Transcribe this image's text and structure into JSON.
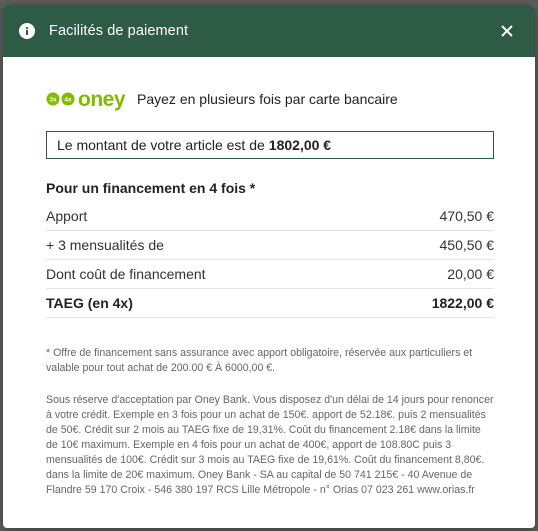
{
  "header": {
    "title": "Facilités de paiement",
    "info_icon": "info-icon",
    "close_icon": "close-icon",
    "background_color": "#2e5b45"
  },
  "brand": {
    "logo_small_1": "3x",
    "logo_small_2": "4x",
    "logo_text": "oney",
    "logo_color": "#81bc00",
    "tagline": "Payez en plusieurs fois par carte bancaire"
  },
  "amount_box": {
    "prefix": "Le montant de votre article est de",
    "value": "1802,00 €"
  },
  "financing": {
    "title": "Pour un financement en 4 fois *",
    "rows": [
      {
        "label": "Apport",
        "value": "470,50 €"
      },
      {
        "label": "+ 3 mensualités de",
        "value": "450,50 €"
      },
      {
        "label": "Dont coût de financement",
        "value": "20,00 €"
      },
      {
        "label": "TAEG (en 4x)",
        "value": "1822,00 €"
      }
    ]
  },
  "footnote": "* Offre de financement sans assurance avec apport obligatoire, réservée aux particuliers et valable pour tout achat de 200.00 € À 6000,00 €.",
  "legal": "Sous réserve d'acceptation par Oney Bank. Vous disposez d'un délai de 14 jours pour renoncer à votre crédit. Exemple en 3 fois pour un achat de 150€. apport de 52.18€. puis 2 mensualités de 50€. Crédit sur 2 mois au TAEG fixe de 19,31%. Coût du financement 2.18€ dans la limite de 10€ maximum. Exemple en 4 fois pour un achat de 400€, apport de 108.80C puis 3 mensualités de 100€. Crédit sur 3 mois au TAEG fixe de 19,61%. Coût du financement 8,80€. dans la limite de 20€ maximum. Oney Bank - SA au capital de 50 741 215€ - 40 Avenue de Flandre 59 170 Croix - 546 380 197 RCS Lille Métropole - n° Orias 07 023 261 www.orias.fr"
}
